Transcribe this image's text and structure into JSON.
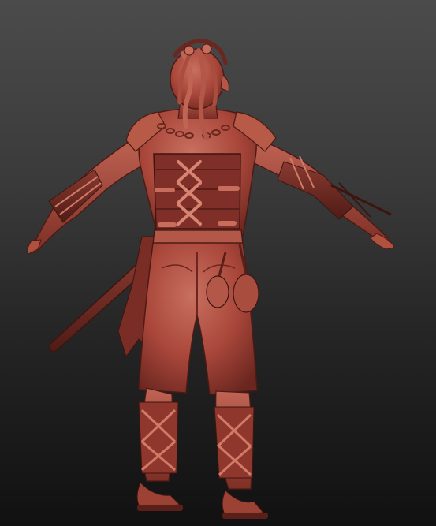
{
  "scene": {
    "subject_icon": "sculpted-character-figure",
    "material_color": "#a8463a",
    "material_shadow": "#5e221c",
    "material_highlight": "#cf7868",
    "background_top": "#4b4b4b",
    "background_bottom": "#111111"
  }
}
